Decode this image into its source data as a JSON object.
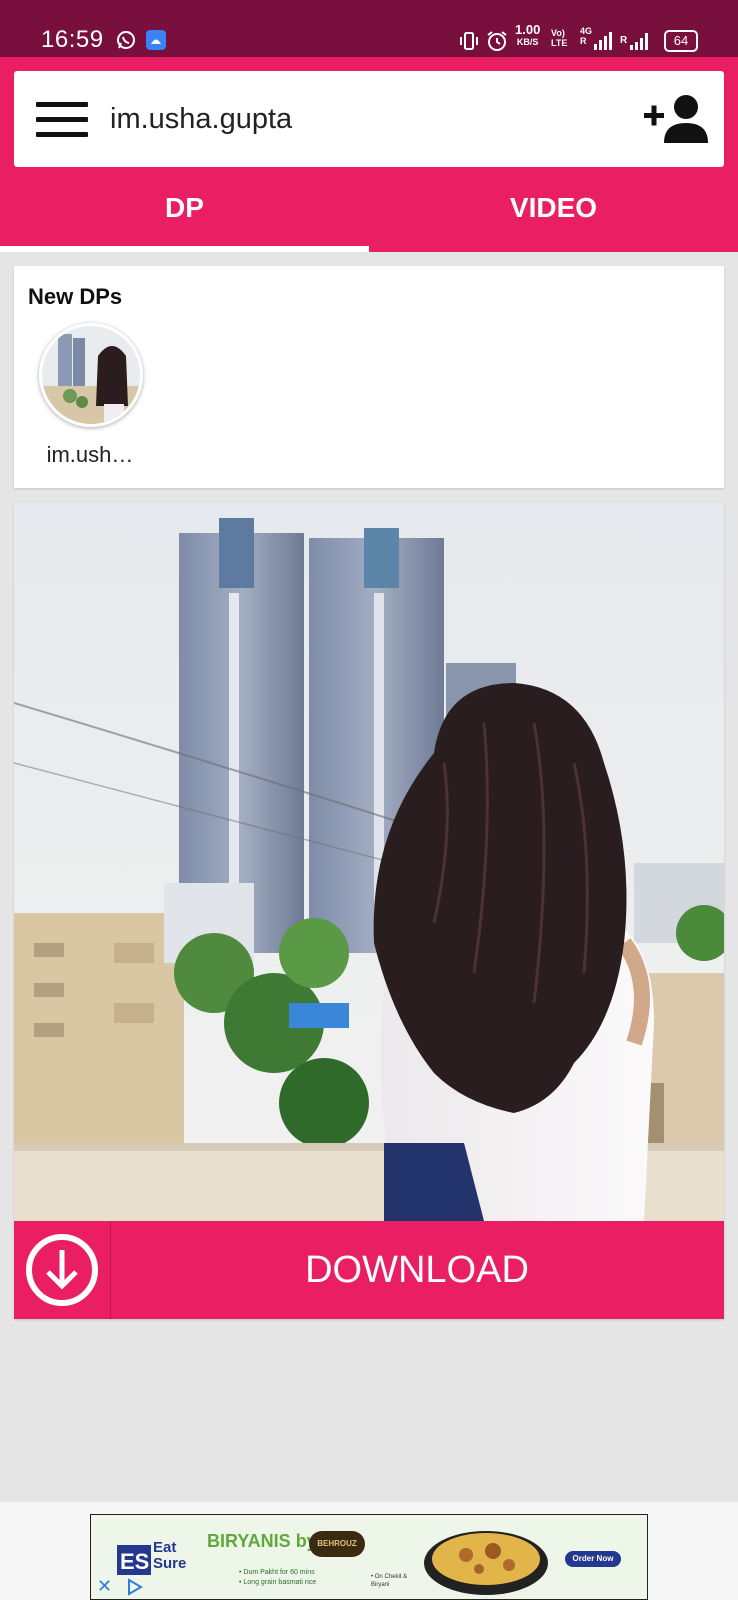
{
  "status_bar": {
    "time": "16:59",
    "net_speed_value": "1.00",
    "net_speed_unit": "KB/S",
    "volte_top": "Vo)",
    "volte_bottom": "LTE",
    "sig4g_top": "4G",
    "sig4g_bottom": "R",
    "roaming": "R",
    "battery": "64",
    "icons": [
      "whatsapp-icon",
      "android-debug-icon",
      "vibrate-icon",
      "alarm-icon",
      "signal-icon",
      "battery-icon"
    ]
  },
  "search": {
    "value": "im.usha.gupta",
    "menu_icon": "menu-icon",
    "add_icon": "add-user-icon"
  },
  "tabs": [
    {
      "label": "DP",
      "active": true
    },
    {
      "label": "VIDEO",
      "active": false
    }
  ],
  "new_dps": {
    "title": "New DPs",
    "items": [
      {
        "name": "im.ush…"
      }
    ]
  },
  "photo": {
    "description_icon": "profile-photo"
  },
  "download": {
    "label": "DOWNLOAD",
    "icon": "download-icon"
  },
  "ad": {
    "brand_eat": "Eat",
    "brand_sure": "Sure",
    "headline": "BIRYANIS by",
    "partner": "BEHROUZ",
    "bullet_1": "• Dum Pakht for 60 mins",
    "bullet_2": "• Long grain basmati rice",
    "side_1": "• On Chekit &",
    "side_2": "Biryani",
    "cta": "Order Now",
    "close_glyph": "✕"
  },
  "colors": {
    "status_bar": "#780f3c",
    "accent": "#e91e63",
    "background": "#e5e5e5",
    "card": "#ffffff"
  }
}
